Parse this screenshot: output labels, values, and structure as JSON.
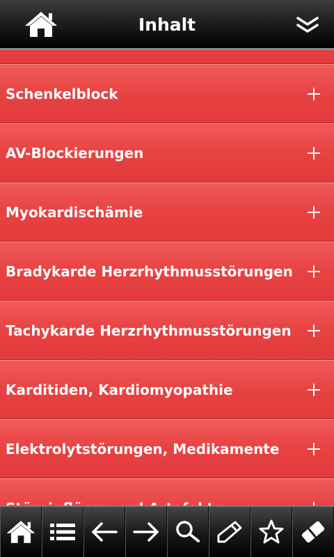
{
  "header": {
    "title": "Inhalt",
    "home_icon": "home-icon",
    "menu_icon": "double-chevron-down-icon"
  },
  "list": {
    "items": [
      {
        "label": ""
      },
      {
        "label": "Schenkelblock"
      },
      {
        "label": "AV-Blockierungen"
      },
      {
        "label": "Myokardischämie"
      },
      {
        "label": "Bradykarde Herzrhythmusstörungen"
      },
      {
        "label": "Tachykarde Herzrhythmusstörungen"
      },
      {
        "label": "Karditiden, Kardiomyopathie"
      },
      {
        "label": "Elektrolytstörungen, Medikamente"
      },
      {
        "label": "Störeinflüsse und Artefakte"
      }
    ],
    "expand_icon": "plus-icon"
  },
  "toolbar": {
    "icons": [
      "home-icon",
      "list-icon",
      "arrow-left-icon",
      "arrow-right-icon",
      "search-icon",
      "pencil-icon",
      "star-icon",
      "eraser-icon"
    ]
  },
  "colors": {
    "row_red": "#e84242",
    "bar_black": "#1a1a1a",
    "text": "#ffffff"
  }
}
